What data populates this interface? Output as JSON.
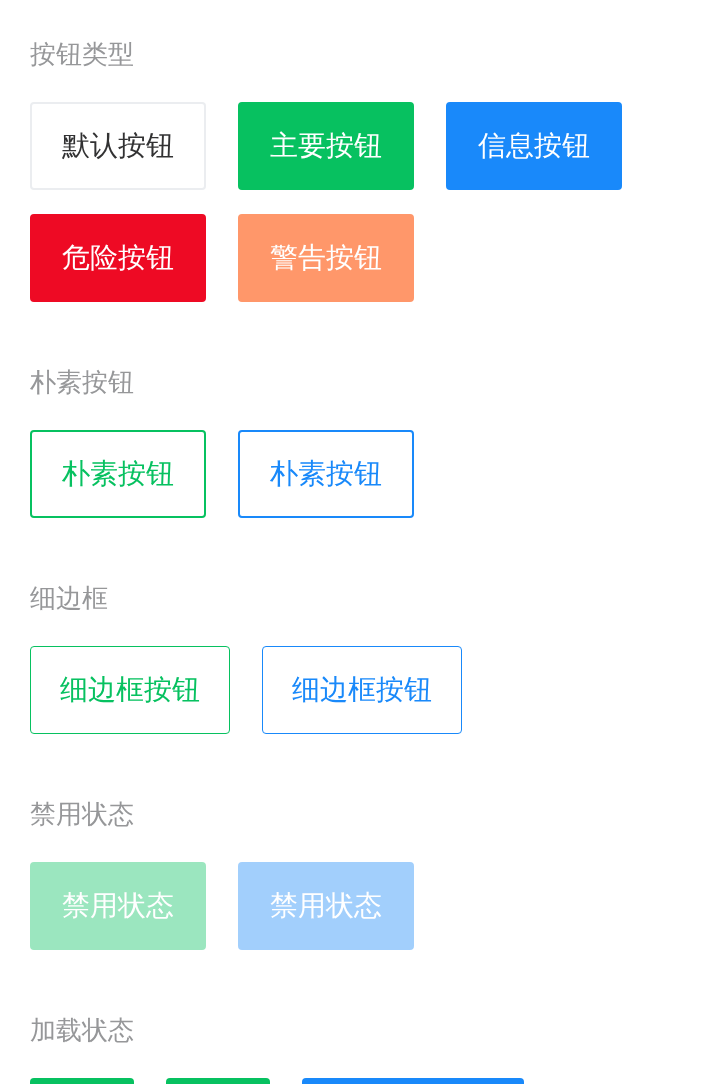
{
  "sections": [
    {
      "title": "按钮类型",
      "buttons": [
        {
          "label": "默认按钮",
          "kind": "default",
          "disabled": false
        },
        {
          "label": "主要按钮",
          "kind": "primary",
          "disabled": false
        },
        {
          "label": "信息按钮",
          "kind": "info",
          "disabled": false
        },
        {
          "label": "危险按钮",
          "kind": "danger",
          "disabled": false
        },
        {
          "label": "警告按钮",
          "kind": "warning",
          "disabled": false
        }
      ]
    },
    {
      "title": "朴素按钮",
      "buttons": [
        {
          "label": "朴素按钮",
          "kind": "plain",
          "color": "#07c160",
          "disabled": false
        },
        {
          "label": "朴素按钮",
          "kind": "plain",
          "color": "#1989fa",
          "disabled": false
        }
      ]
    },
    {
      "title": "细边框",
      "buttons": [
        {
          "label": "细边框按钮",
          "kind": "hairline",
          "color": "#07c160",
          "disabled": false
        },
        {
          "label": "细边框按钮",
          "kind": "hairline",
          "color": "#1989fa",
          "disabled": false
        }
      ]
    },
    {
      "title": "禁用状态",
      "buttons": [
        {
          "label": "禁用状态",
          "kind": "primary",
          "disabled": true
        },
        {
          "label": "禁用状态",
          "kind": "info",
          "disabled": true
        }
      ]
    },
    {
      "title": "加载状态",
      "buttons": [
        {
          "kind": "loading",
          "color": "#07c160",
          "disabled": false
        },
        {
          "kind": "loading",
          "color": "#07c160",
          "disabled": false
        },
        {
          "kind": "loadingtext",
          "color": "#1989fa",
          "disabled": false
        }
      ]
    }
  ]
}
